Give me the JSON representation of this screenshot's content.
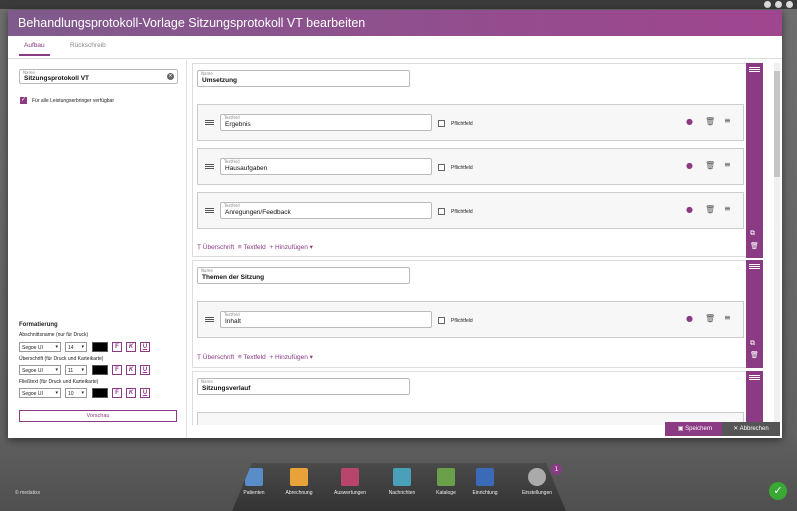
{
  "dialog": {
    "title": "Behandlungsprotokoll-Vorlage Sitzungsprotokoll VT bearbeiten",
    "tabs": [
      "Aufbau",
      "Rückschreib"
    ]
  },
  "left": {
    "name_label": "Name",
    "name_value": "Sitzungsprotokoll VT",
    "all_providers_label": "Für alle Leistungserbringer verfügbar",
    "formatting_title": "Formatierung",
    "rows": [
      {
        "label": "Abschnittsname (nur für Druck)",
        "font": "Segoe UI",
        "size": "14"
      },
      {
        "label": "Überschrift (für Druck und Karteikarte)",
        "font": "Segoe UI",
        "size": "11"
      },
      {
        "label": "Fließtext (für Druck und Karteikarte)",
        "font": "Segoe UI",
        "size": "10"
      }
    ],
    "bold": "F",
    "italic": "K",
    "underline": "U",
    "preview_label": "Vorschau"
  },
  "main": {
    "field_label_name": "Name",
    "field_label_text": "Textfeld",
    "required_label": "Pflichtfeld",
    "add_heading": "Überschrift",
    "add_textfield": "Textfeld",
    "add_more": "Hinzufügen",
    "sections": [
      {
        "name": "Umsetzung",
        "fields": [
          "Ergebnis",
          "Hausaufgaben",
          "Anregungen/Feedback"
        ]
      },
      {
        "name": "Themen der Sitzung",
        "fields": [
          "Inhalt"
        ]
      },
      {
        "name": "Sitzungsverlauf",
        "fields": []
      }
    ]
  },
  "footer": {
    "save_label": "Speichern",
    "cancel_label": "Abbrechen"
  },
  "dock": {
    "items": [
      "Patienten",
      "Abrechnung",
      "Auswertungen",
      "Nachrichten",
      "Kataloge",
      "Einrichtung",
      "Einstellungen"
    ],
    "badge": "1",
    "copyright": "© medatixx"
  },
  "colors": {
    "accent": "#8b3a84",
    "ok": "#3aa835"
  }
}
